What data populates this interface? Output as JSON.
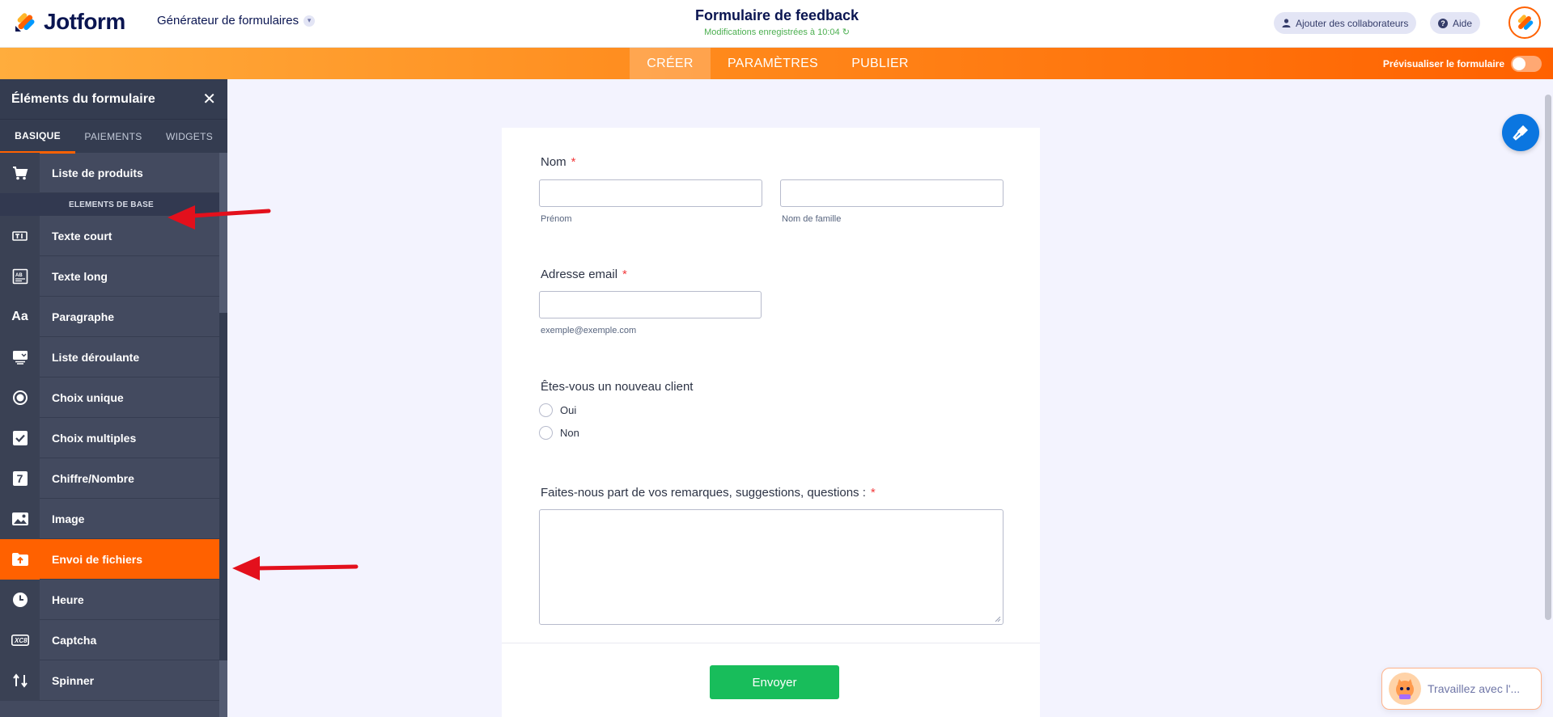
{
  "header": {
    "logo_text": "Jotform",
    "builder_menu": "Générateur de formulaires",
    "form_title": "Formulaire de feedback",
    "save_status": "Modifications enregistrées à 10:04",
    "collab_button": "Ajouter des collaborateurs",
    "help_button": "Aide"
  },
  "nav": {
    "tabs": [
      "CRÉER",
      "PARAMÈTRES",
      "PUBLIER"
    ],
    "active_tab": "CRÉER",
    "preview_label": "Prévisualiser le formulaire",
    "preview_on": false
  },
  "sidebar": {
    "title": "Éléments du formulaire",
    "tabs": [
      "BASIQUE",
      "PAIEMENTS",
      "WIDGETS"
    ],
    "active_tab": "BASIQUE",
    "top_item": "Liste de produits",
    "section_label": "ELEMENTS DE BASE",
    "items": [
      {
        "label": "Texte court",
        "icon": "short-text-icon"
      },
      {
        "label": "Texte long",
        "icon": "long-text-icon"
      },
      {
        "label": "Paragraphe",
        "icon": "paragraph-icon",
        "glyph": "Aa"
      },
      {
        "label": "Liste déroulante",
        "icon": "dropdown-icon"
      },
      {
        "label": "Choix unique",
        "icon": "radio-icon"
      },
      {
        "label": "Choix multiples",
        "icon": "checkbox-icon"
      },
      {
        "label": "Chiffre/Nombre",
        "icon": "number-icon",
        "glyph": "7"
      },
      {
        "label": "Image",
        "icon": "image-icon"
      },
      {
        "label": "Envoi de fichiers",
        "icon": "file-upload-icon"
      },
      {
        "label": "Heure",
        "icon": "clock-icon"
      },
      {
        "label": "Captcha",
        "icon": "captcha-icon"
      },
      {
        "label": "Spinner",
        "icon": "spinner-icon"
      }
    ],
    "active_item": "Envoi de fichiers"
  },
  "form": {
    "name_label": "Nom",
    "first_name_sublabel": "Prénom",
    "last_name_sublabel": "Nom de famille",
    "email_label": "Adresse email",
    "email_sublabel": "exemple@exemple.com",
    "new_client_label": "Êtes-vous un nouveau client",
    "options": [
      "Oui",
      "Non"
    ],
    "remarks_label": "Faites-nous part de vos remarques, suggestions, questions :",
    "required_marker": "*",
    "submit_label": "Envoyer"
  },
  "chat": {
    "text": "Travaillez avec l'..."
  },
  "colors": {
    "accent": "#ff6100",
    "submit": "#18bd5b",
    "sidebar": "#434a5f",
    "annotation": "#e3101c"
  }
}
